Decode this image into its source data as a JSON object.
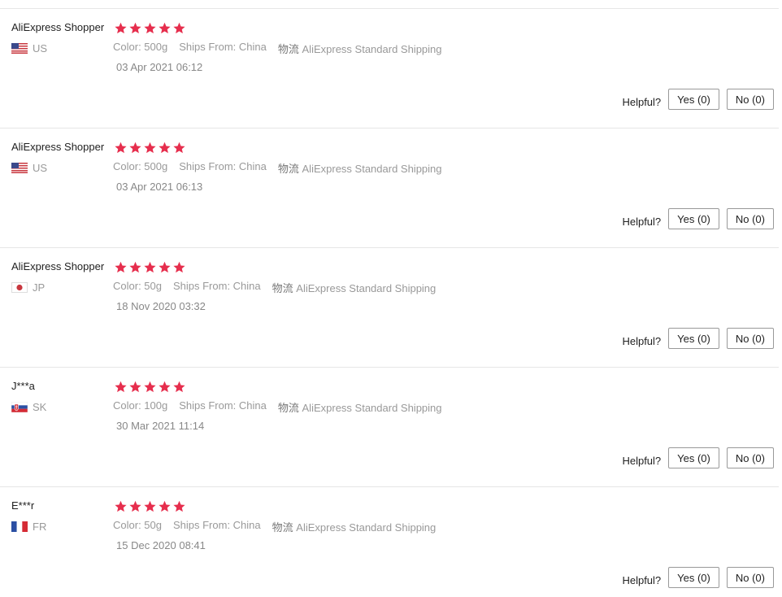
{
  "reviews": [
    {
      "user": "AliExpress Shopper",
      "country": "US",
      "flag": "us-flag",
      "rating": 5,
      "color": "Color: 500g",
      "ships_from": "Ships From: China",
      "shipping_key": "物流",
      "shipping_value": "AliExpress Standard Shipping",
      "date": "03 Apr 2021 06:12",
      "helpful_label": "Helpful?",
      "yes": "Yes (0)",
      "no": "No (0)"
    },
    {
      "user": "AliExpress Shopper",
      "country": "US",
      "flag": "us-flag",
      "rating": 5,
      "color": "Color: 500g",
      "ships_from": "Ships From: China",
      "shipping_key": "物流",
      "shipping_value": "AliExpress Standard Shipping",
      "date": "03 Apr 2021 06:13",
      "helpful_label": "Helpful?",
      "yes": "Yes (0)",
      "no": "No (0)"
    },
    {
      "user": "AliExpress Shopper",
      "country": "JP",
      "flag": "jp-flag",
      "rating": 5,
      "color": "Color: 50g",
      "ships_from": "Ships From: China",
      "shipping_key": "物流",
      "shipping_value": "AliExpress Standard Shipping",
      "date": "18 Nov 2020 03:32",
      "helpful_label": "Helpful?",
      "yes": "Yes (0)",
      "no": "No (0)"
    },
    {
      "user": "J***a",
      "country": "SK",
      "flag": "sk-flag",
      "rating": 5,
      "color": "Color: 100g",
      "ships_from": "Ships From: China",
      "shipping_key": "物流",
      "shipping_value": "AliExpress Standard Shipping",
      "date": "30 Mar 2021 11:14",
      "helpful_label": "Helpful?",
      "yes": "Yes (0)",
      "no": "No (0)"
    },
    {
      "user": "E***r",
      "country": "FR",
      "flag": "fr-flag",
      "rating": 5,
      "color": "Color: 50g",
      "ships_from": "Ships From: China",
      "shipping_key": "物流",
      "shipping_value": "AliExpress Standard Shipping",
      "date": "15 Dec 2020 08:41",
      "helpful_label": "Helpful?",
      "yes": "Yes (0)",
      "no": "No (0)"
    }
  ],
  "colors": {
    "star": "#e62e4d",
    "divider": "#e6e6e6"
  }
}
